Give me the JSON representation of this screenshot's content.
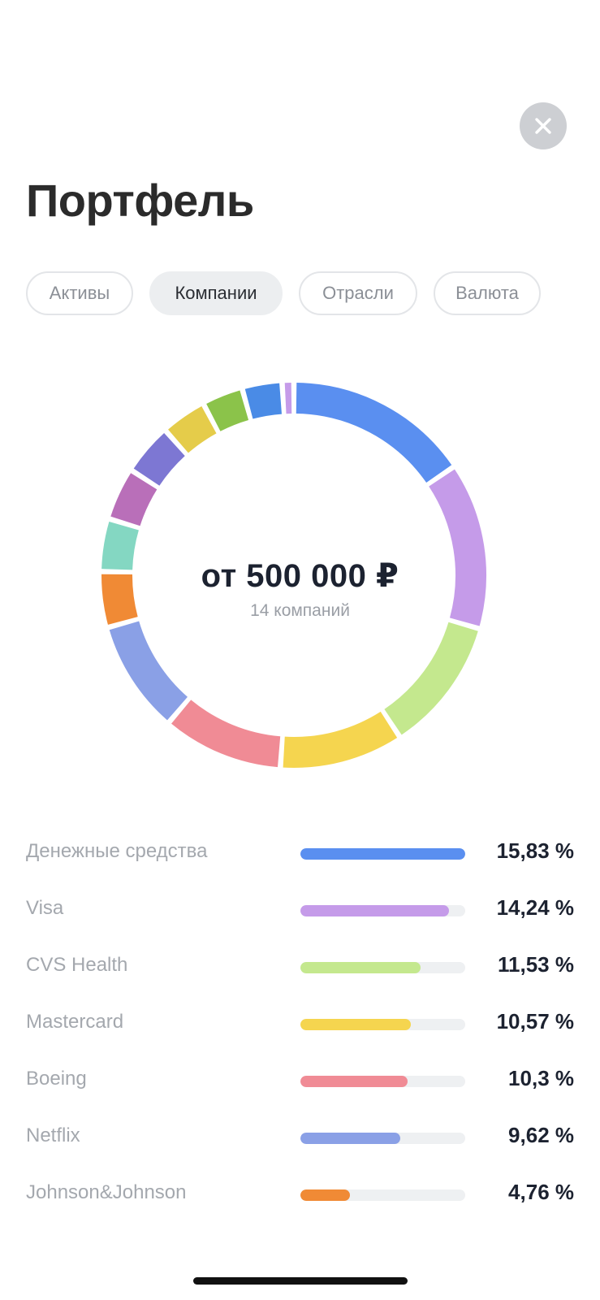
{
  "header": {
    "title": "Портфель",
    "close_icon": "close-icon"
  },
  "tabs": [
    {
      "label": "Активы",
      "active": false
    },
    {
      "label": "Компании",
      "active": true
    },
    {
      "label": "Отрасли",
      "active": false
    },
    {
      "label": "Валюта",
      "active": false
    }
  ],
  "summary": {
    "value": "от 500 000 ₽",
    "subtitle": "14 компаний"
  },
  "chart_data": {
    "type": "pie",
    "variant": "donut",
    "segments": [
      {
        "label": "Денежные средства",
        "value": 15.83,
        "color": "#5a8ff0"
      },
      {
        "label": "Visa",
        "value": 14.24,
        "color": "#c59be9"
      },
      {
        "label": "CVS Health",
        "value": 11.53,
        "color": "#c4e88e"
      },
      {
        "label": "Mastercard",
        "value": 10.57,
        "color": "#f5d54f"
      },
      {
        "label": "Boeing",
        "value": 10.3,
        "color": "#f08b95"
      },
      {
        "label": "Netflix",
        "value": 9.62,
        "color": "#8aa0e6"
      },
      {
        "label": "Johnson&Johnson",
        "value": 4.76,
        "color": "#f08a35"
      },
      {
        "label": "",
        "value": 4.5,
        "color": "#84d7c2"
      },
      {
        "label": "",
        "value": 4.5,
        "color": "#b96fb9"
      },
      {
        "label": "",
        "value": 4.4,
        "color": "#7d77d3"
      },
      {
        "label": "",
        "value": 3.9,
        "color": "#e5cc4a"
      },
      {
        "label": "",
        "value": 3.5,
        "color": "#8bc34a"
      },
      {
        "label": "",
        "value": 3.4,
        "color": "#4a8be6"
      },
      {
        "label": "",
        "value": 1.0,
        "color": "#c59be9"
      }
    ]
  },
  "legend": [
    {
      "name": "Денежные средства",
      "percent": "15,83 %",
      "share": 15.83,
      "color": "#5a8ff0"
    },
    {
      "name": "Visa",
      "percent": "14,24 %",
      "share": 14.24,
      "color": "#c59be9"
    },
    {
      "name": "CVS Health",
      "percent": "11,53 %",
      "share": 11.53,
      "color": "#c4e88e"
    },
    {
      "name": "Mastercard",
      "percent": "10,57 %",
      "share": 10.57,
      "color": "#f5d54f"
    },
    {
      "name": "Boeing",
      "percent": "10,3 %",
      "share": 10.3,
      "color": "#f08b95"
    },
    {
      "name": "Netflix",
      "percent": "9,62 %",
      "share": 9.62,
      "color": "#8aa0e6"
    },
    {
      "name": "Johnson&Johnson",
      "percent": "4,76 %",
      "share": 4.76,
      "color": "#f08a35"
    }
  ]
}
